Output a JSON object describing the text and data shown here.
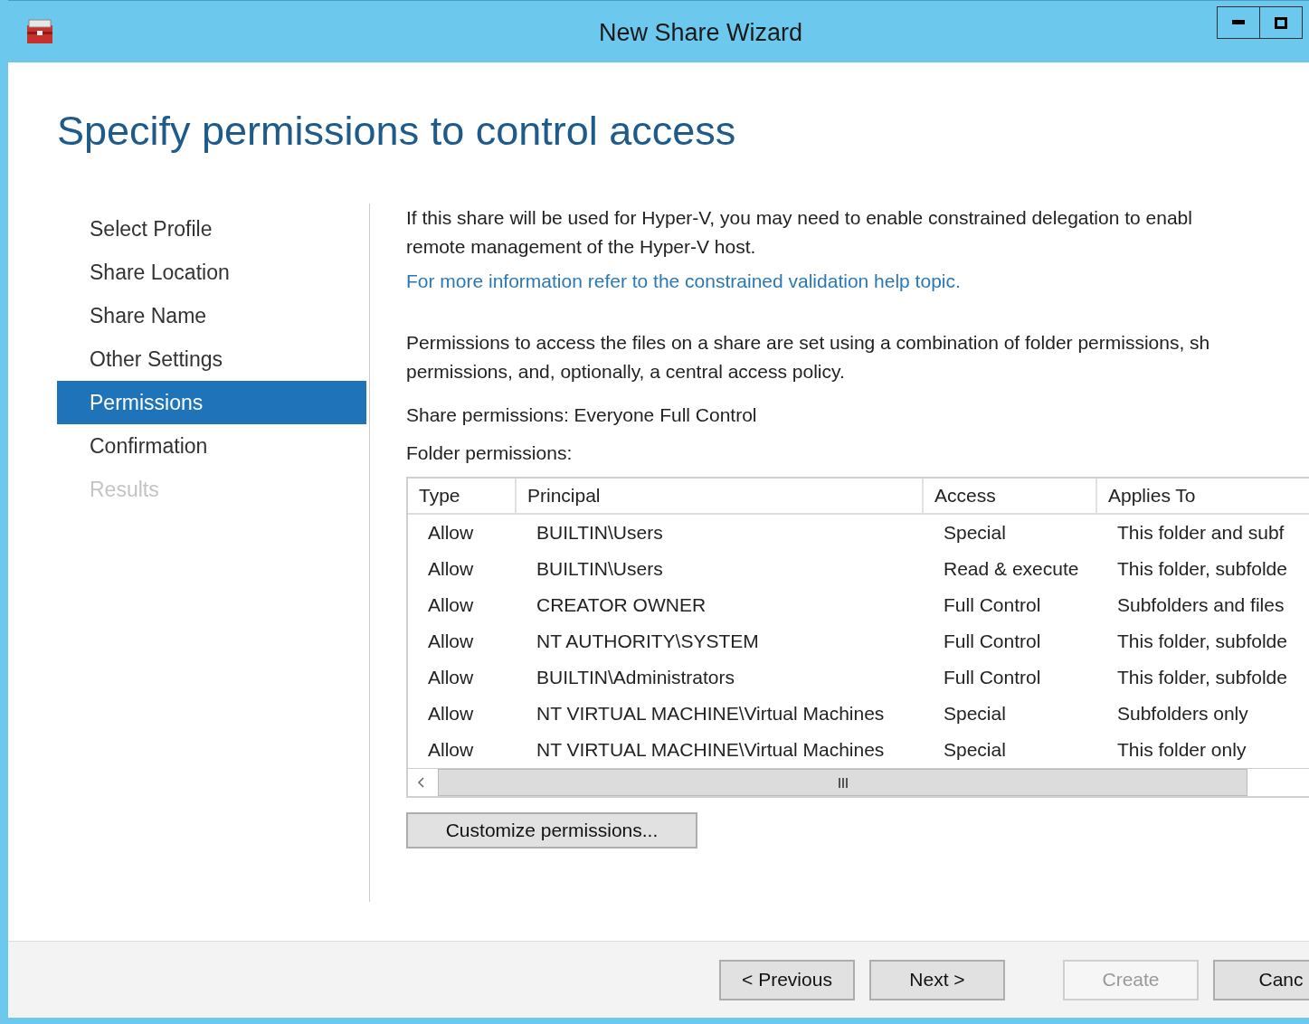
{
  "window": {
    "title": "New Share Wizard"
  },
  "heading": "Specify permissions to control access",
  "steps": [
    {
      "label": "Select Profile",
      "selected": false,
      "disabled": false
    },
    {
      "label": "Share Location",
      "selected": false,
      "disabled": false
    },
    {
      "label": "Share Name",
      "selected": false,
      "disabled": false
    },
    {
      "label": "Other Settings",
      "selected": false,
      "disabled": false
    },
    {
      "label": "Permissions",
      "selected": true,
      "disabled": false
    },
    {
      "label": "Confirmation",
      "selected": false,
      "disabled": false
    },
    {
      "label": "Results",
      "selected": false,
      "disabled": true
    }
  ],
  "intro_lines": [
    "If this share will be used for Hyper-V, you may need to enable constrained delegation to enabl",
    "remote management of the Hyper-V host."
  ],
  "help_link": "For more information refer to the constrained validation help topic.",
  "permissions_lines": [
    "Permissions to access the files on a share are set using a combination of folder permissions, sh",
    "permissions, and, optionally, a central access policy."
  ],
  "share_permissions": "Share permissions: Everyone Full Control",
  "folder_permissions_label": "Folder permissions:",
  "table": {
    "columns": [
      "Type",
      "Principal",
      "Access",
      "Applies To"
    ],
    "rows": [
      [
        "Allow",
        "BUILTIN\\Users",
        "Special",
        "This folder and subf"
      ],
      [
        "Allow",
        "BUILTIN\\Users",
        "Read & execute",
        "This folder, subfolde"
      ],
      [
        "Allow",
        "CREATOR OWNER",
        "Full Control",
        "Subfolders and files"
      ],
      [
        "Allow",
        "NT AUTHORITY\\SYSTEM",
        "Full Control",
        "This folder, subfolde"
      ],
      [
        "Allow",
        "BUILTIN\\Administrators",
        "Full Control",
        "This folder, subfolde"
      ],
      [
        "Allow",
        "NT VIRTUAL MACHINE\\Virtual Machines",
        "Special",
        "Subfolders only"
      ],
      [
        "Allow",
        "NT VIRTUAL MACHINE\\Virtual Machines",
        "Special",
        "This folder only"
      ]
    ]
  },
  "customize_button": "Customize permissions...",
  "buttons": [
    {
      "label": "< Previous",
      "disabled": false
    },
    {
      "label": "Next >",
      "disabled": false
    },
    {
      "label": "Create",
      "disabled": true
    },
    {
      "label": "Canc",
      "disabled": false
    }
  ]
}
